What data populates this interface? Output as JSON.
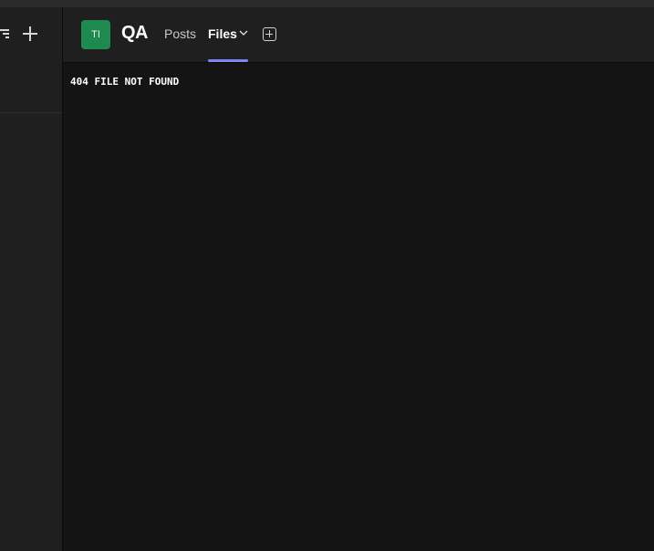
{
  "team": {
    "avatar_initials": "TI",
    "avatar_color": "#1f8a4f",
    "name": "QA"
  },
  "tabs": [
    {
      "label": "Posts",
      "active": false
    },
    {
      "label": "Files",
      "active": true,
      "has_dropdown": true
    }
  ],
  "accent_color": "#7f85f5",
  "icons": {
    "left_toolbar": [
      "filter-icon",
      "plus-icon"
    ],
    "tab_dropdown": "chevron-down-icon",
    "add_tab": "add-tab-icon"
  },
  "content": {
    "message": "404 FILE NOT FOUND"
  }
}
